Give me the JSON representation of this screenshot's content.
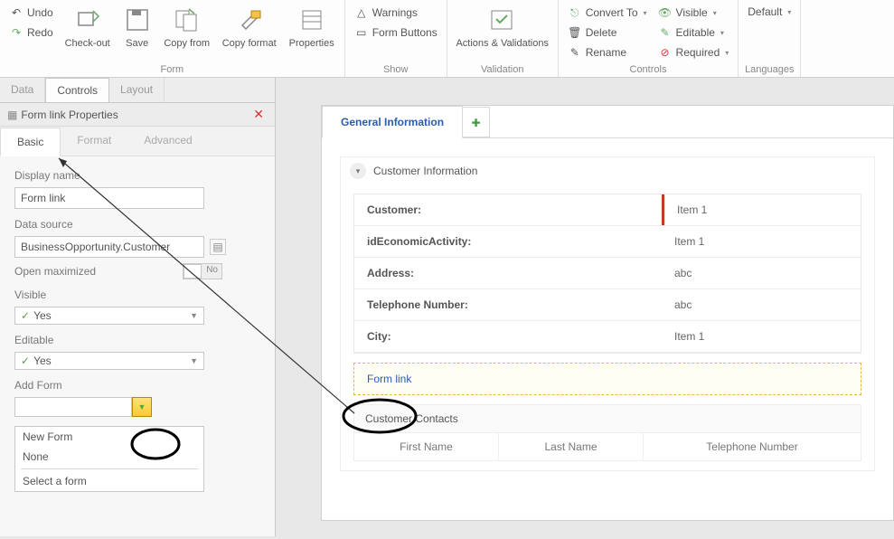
{
  "ribbon": {
    "undo": "Undo",
    "redo": "Redo",
    "checkout": "Check-out",
    "save": "Save",
    "copyfrom": "Copy from",
    "copyformat": "Copy format",
    "properties": "Properties",
    "group_form": "Form",
    "warnings": "Warnings",
    "formbuttons": "Form Buttons",
    "group_show": "Show",
    "actionsvalidations": "Actions & Validations",
    "group_validation": "Validation",
    "convertto": "Convert To",
    "delete": "Delete",
    "rename": "Rename",
    "visible": "Visible",
    "editable": "Editable",
    "required": "Required",
    "group_controls": "Controls",
    "default": "Default",
    "group_languages": "Languages"
  },
  "panel": {
    "tab_data": "Data",
    "tab_controls": "Controls",
    "tab_layout": "Layout",
    "prop_title": "Form link Properties",
    "tab_basic": "Basic",
    "tab_format": "Format",
    "tab_advanced": "Advanced",
    "displayname_label": "Display name",
    "displayname_value": "Form link",
    "datasource_label": "Data source",
    "datasource_value": "BusinessOpportunity.Customer",
    "openmax_label": "Open maximized",
    "openmax_value": "No",
    "visible_label": "Visible",
    "visible_value": "Yes",
    "editable_label": "Editable",
    "editable_value": "Yes",
    "addform_label": "Add Form",
    "menu_newform": "New Form",
    "menu_none": "None",
    "menu_select": "Select a form"
  },
  "form": {
    "tab_general": "General Information",
    "section_customer": "Customer Information",
    "f_customer": "Customer:",
    "f_customer_v": "Item 1",
    "f_econ": "idEconomicActivity:",
    "f_econ_v": "Item 1",
    "f_addr": "Address:",
    "f_addr_v": "abc",
    "f_tel": "Telephone Number:",
    "f_tel_v": "abc",
    "f_city": "City:",
    "f_city_v": "Item 1",
    "formlink": "Form link",
    "contacts_hdr": "Customer Contacts",
    "col_first": "First Name",
    "col_last": "Last Name",
    "col_tel": "Telephone Number"
  }
}
